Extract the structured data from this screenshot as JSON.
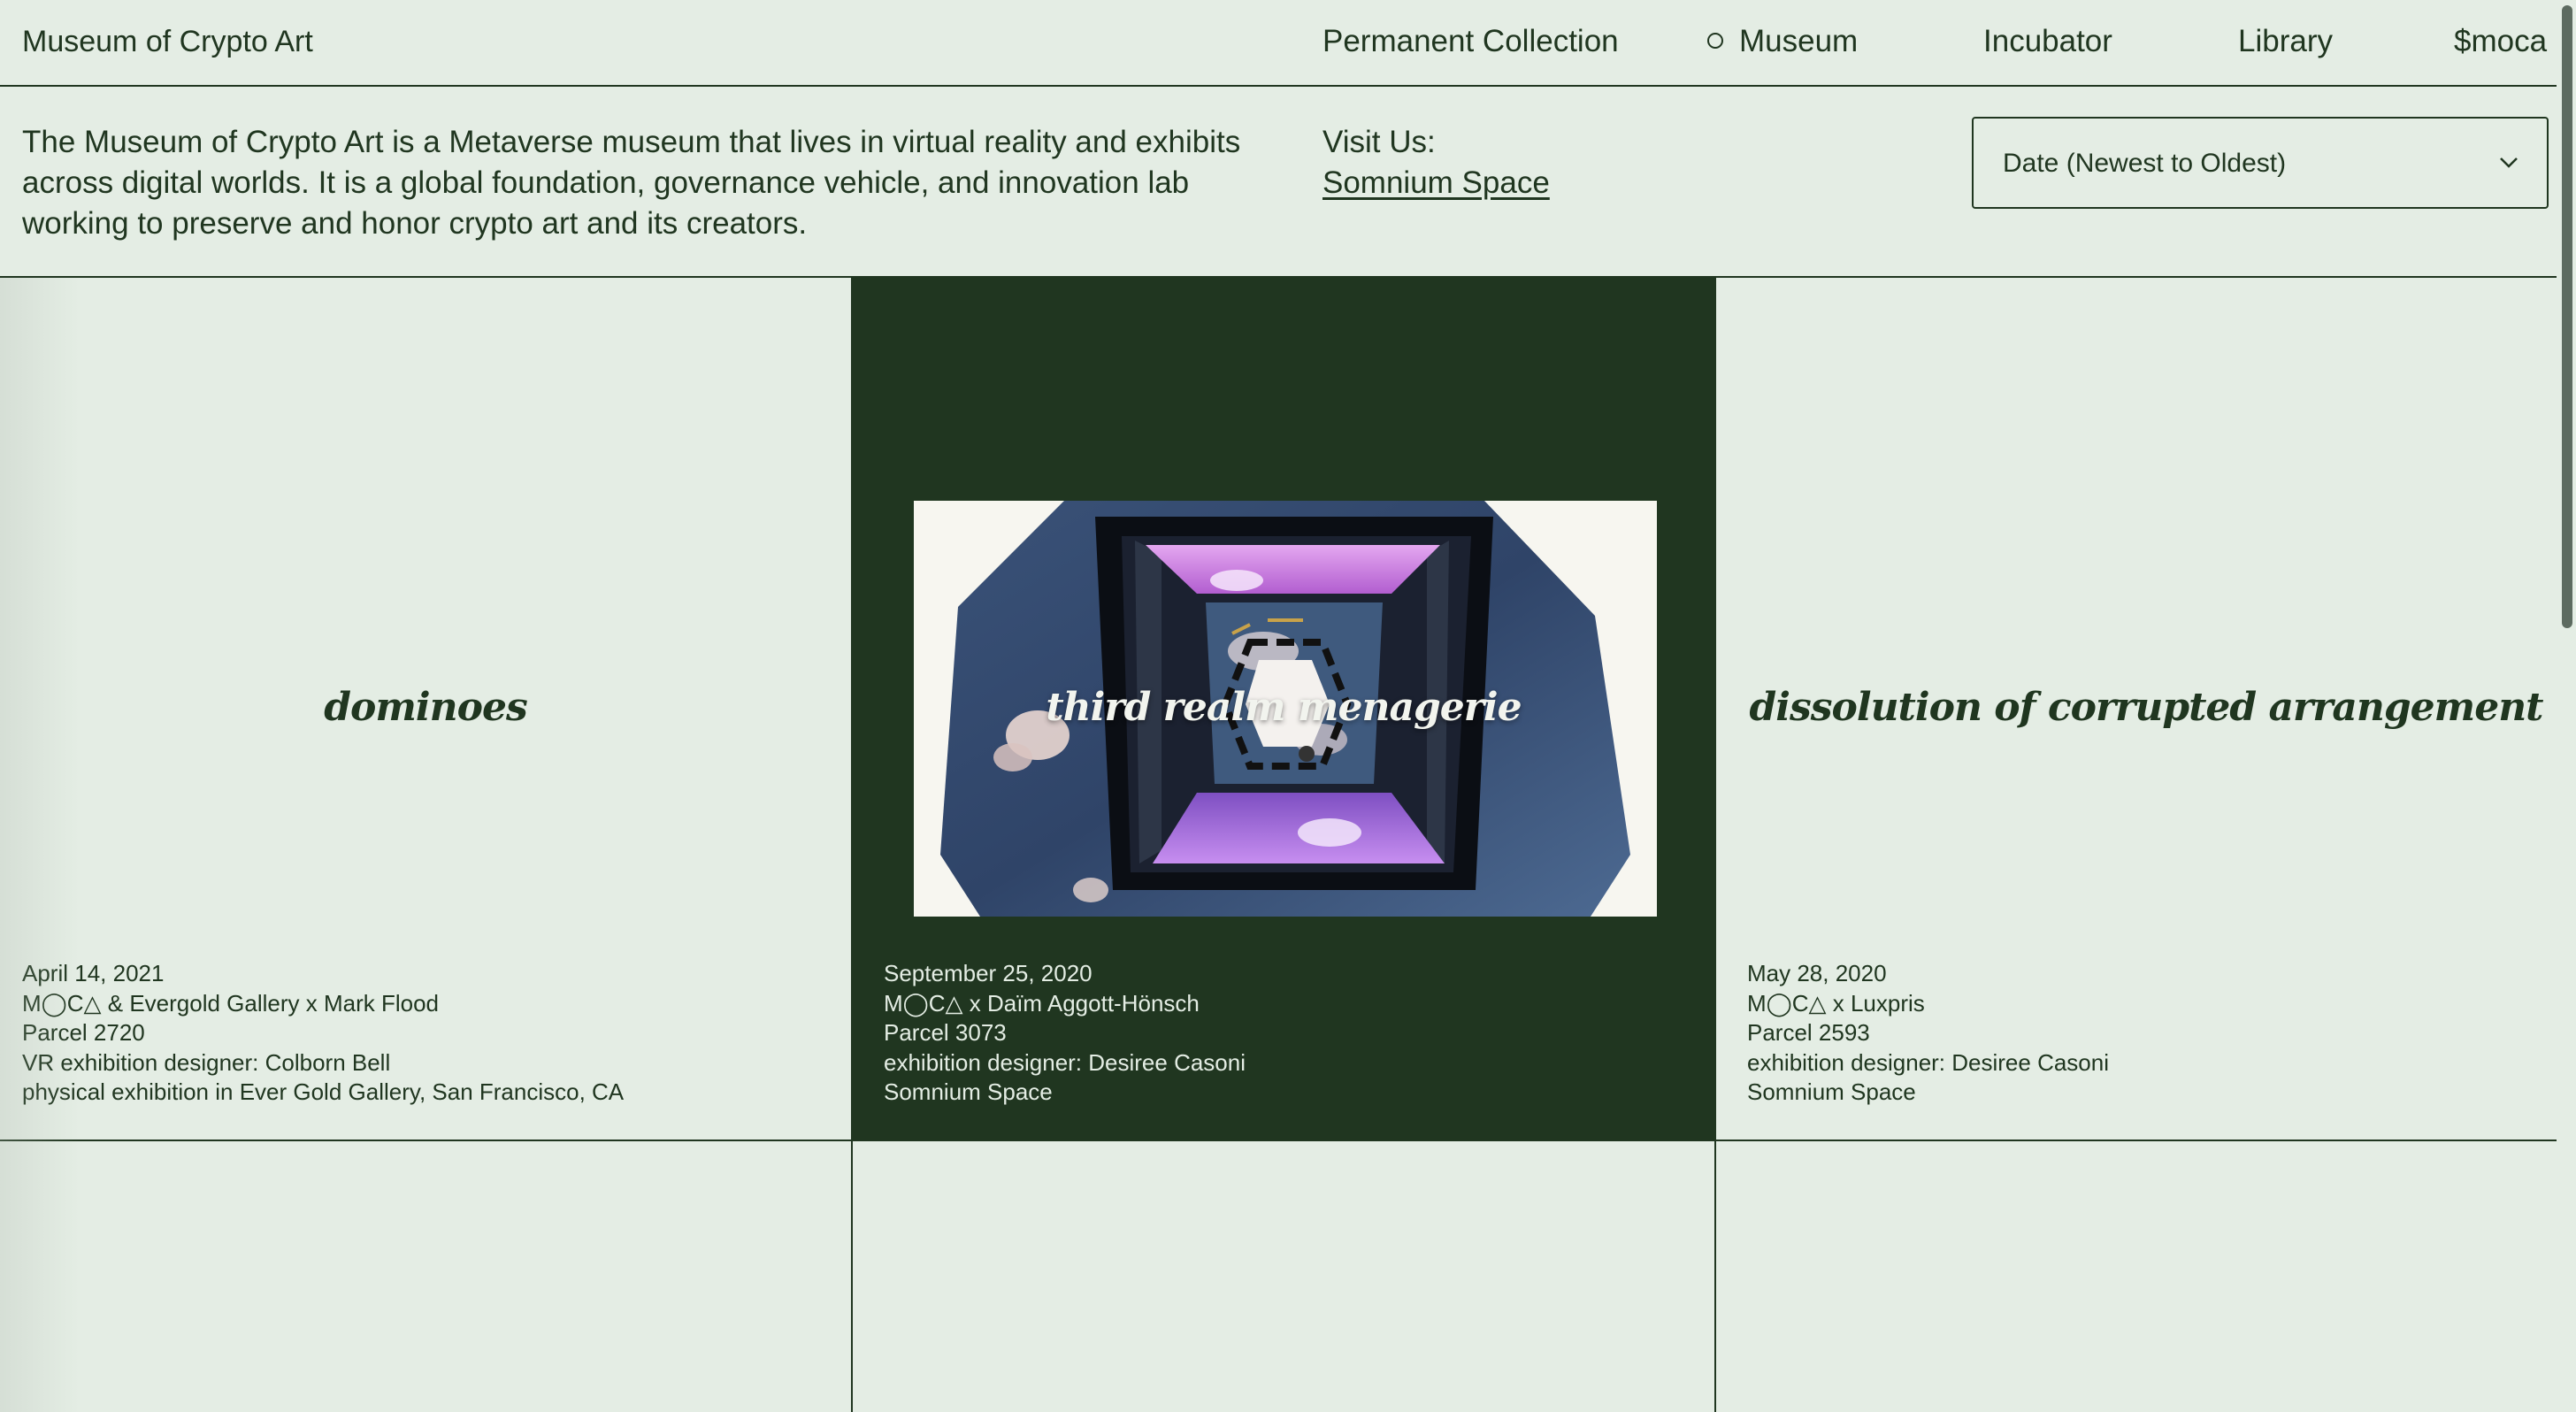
{
  "header": {
    "site_title": "Museum of Crypto Art",
    "nav": {
      "collection": "Permanent Collection",
      "museum": "Museum",
      "incubator": "Incubator",
      "library": "Library",
      "moca": "$moca"
    }
  },
  "intro": {
    "text": "The Museum of Crypto Art is a Metaverse museum that lives in virtual reality and exhibits across digital worlds. It is a global foundation, governance vehicle, and innovation lab working to preserve and honor crypto art and its creators.",
    "visit_label": "Visit Us:",
    "visit_link": "Somnium Space"
  },
  "sort": {
    "selected": "Date (Newest to Oldest)"
  },
  "exhibitions": [
    {
      "title": "dominoes",
      "date": "April 14, 2021",
      "collab": "M◯C△ & Evergold Gallery x Mark Flood",
      "parcel": "Parcel 2720",
      "designer": "VR exhibition designer: Colborn Bell",
      "location": "physical exhibition in Ever Gold Gallery, San Francisco, CA"
    },
    {
      "title": "third realm menagerie",
      "date": "September 25, 2020",
      "collab": "M◯C△ x Daïm Aggott-Hönsch",
      "parcel": "Parcel 3073",
      "designer": "exhibition designer: Desiree Casoni",
      "location": "Somnium Space"
    },
    {
      "title": "dissolution of corrupted arrangement",
      "date": "May 28, 2020",
      "collab": "M◯C△ x Luxpris",
      "parcel": "Parcel 2593",
      "designer": "exhibition designer: Desiree Casoni",
      "location": "Somnium Space"
    }
  ],
  "colors": {
    "background": "#e4ede4",
    "ink": "#203620",
    "highlight_cell": "#203620"
  }
}
